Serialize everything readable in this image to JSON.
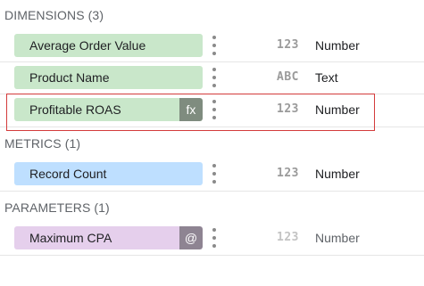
{
  "dimensions": {
    "header": "DIMENSIONS (3)",
    "fields": [
      {
        "name": "Average Order Value",
        "type_icon": "123",
        "type_label": "Number",
        "badge": ""
      },
      {
        "name": "Product Name",
        "type_icon": "ABC",
        "type_label": "Text",
        "badge": ""
      },
      {
        "name": "Profitable ROAS",
        "type_icon": "123",
        "type_label": "Number",
        "badge": "fx"
      }
    ]
  },
  "metrics": {
    "header": "METRICS (1)",
    "fields": [
      {
        "name": "Record Count",
        "type_icon": "123",
        "type_label": "Number"
      }
    ]
  },
  "parameters": {
    "header": "PARAMETERS (1)",
    "fields": [
      {
        "name": "Maximum CPA",
        "type_icon": "123",
        "type_label": "Number",
        "badge": "@"
      }
    ]
  },
  "colors": {
    "dimension_chip": "#c9e7ca",
    "metric_chip": "#bedfff",
    "parameter_chip": "#e5cfec",
    "highlight": "#d33b3b"
  }
}
